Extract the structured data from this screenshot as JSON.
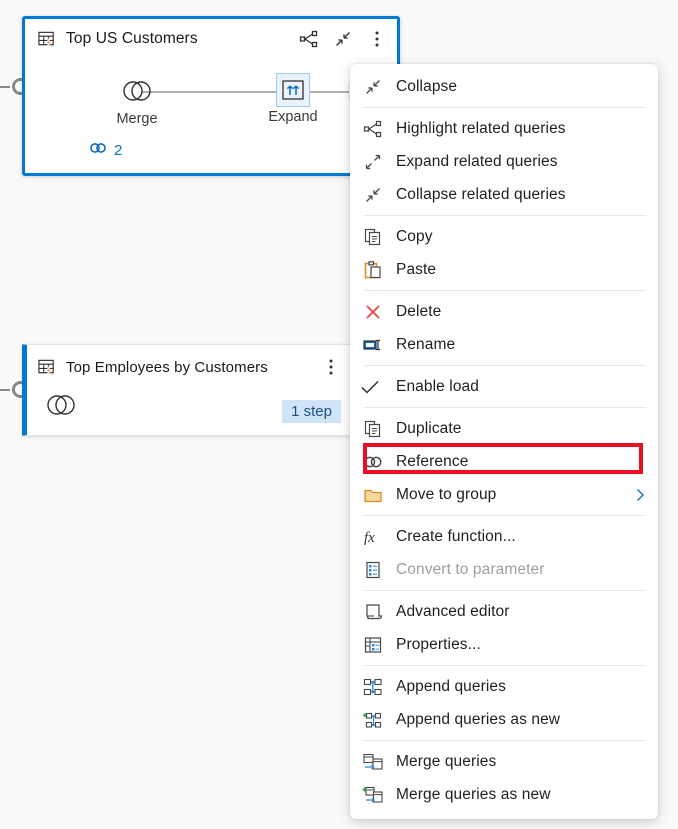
{
  "canvas": {
    "background": "#faf9f8",
    "accent": "#0078d4",
    "highlight_color": "#e81123"
  },
  "queries": [
    {
      "title": "Top US Customers",
      "selected": true,
      "icon": "table-query-icon",
      "header_actions": [
        {
          "name": "highlight-related-queries-icon",
          "label": "Highlight related queries"
        },
        {
          "name": "collapse-icon",
          "label": "Collapse"
        },
        {
          "name": "more-options-icon",
          "label": "More options"
        }
      ],
      "steps": [
        {
          "label": "Merge",
          "icon": "merge-icon",
          "active": false
        },
        {
          "label": "Expand",
          "icon": "expand-columns-icon",
          "active": true
        }
      ],
      "add_step_label": "+",
      "reference_count": "2",
      "reference_icon": "reference-link-icon"
    },
    {
      "title": "Top Employees by Customers",
      "selected": false,
      "icon": "table-query-icon",
      "header_actions": [
        {
          "name": "more-options-icon",
          "label": "More options"
        }
      ],
      "steps": [
        {
          "label": "",
          "icon": "merge-icon",
          "active": false
        }
      ],
      "step_badge": "1 step"
    }
  ],
  "context_menu": {
    "highlighted_item": "Reference",
    "groups": [
      {
        "items": [
          {
            "label": "Collapse",
            "icon": "collapse-icon",
            "disabled": false,
            "submenu": false
          }
        ]
      },
      {
        "items": [
          {
            "label": "Highlight related queries",
            "icon": "highlight-related-queries-icon",
            "disabled": false,
            "submenu": false
          },
          {
            "label": "Expand related queries",
            "icon": "expand-related-queries-icon",
            "disabled": false,
            "submenu": false
          },
          {
            "label": "Collapse related queries",
            "icon": "collapse-related-queries-icon",
            "disabled": false,
            "submenu": false
          }
        ]
      },
      {
        "items": [
          {
            "label": "Copy",
            "icon": "copy-icon",
            "disabled": false,
            "submenu": false
          },
          {
            "label": "Paste",
            "icon": "paste-icon",
            "disabled": false,
            "submenu": false
          }
        ]
      },
      {
        "items": [
          {
            "label": "Delete",
            "icon": "delete-icon",
            "disabled": false,
            "submenu": false
          },
          {
            "label": "Rename",
            "icon": "rename-icon",
            "disabled": false,
            "submenu": false
          }
        ]
      },
      {
        "items": [
          {
            "label": "Enable load",
            "icon": "checkmark-icon",
            "disabled": false,
            "submenu": false
          }
        ]
      },
      {
        "items": [
          {
            "label": "Duplicate",
            "icon": "duplicate-icon",
            "disabled": false,
            "submenu": false
          },
          {
            "label": "Reference",
            "icon": "reference-link-icon",
            "disabled": false,
            "submenu": false
          },
          {
            "label": "Move to group",
            "icon": "folder-icon",
            "disabled": false,
            "submenu": true
          }
        ]
      },
      {
        "items": [
          {
            "label": "Create function...",
            "icon": "function-icon",
            "disabled": false,
            "submenu": false
          },
          {
            "label": "Convert to parameter",
            "icon": "parameter-icon",
            "disabled": true,
            "submenu": false
          }
        ]
      },
      {
        "items": [
          {
            "label": "Advanced editor",
            "icon": "advanced-editor-icon",
            "disabled": false,
            "submenu": false
          },
          {
            "label": "Properties...",
            "icon": "properties-icon",
            "disabled": false,
            "submenu": false
          }
        ]
      },
      {
        "items": [
          {
            "label": "Append queries",
            "icon": "append-queries-icon",
            "disabled": false,
            "submenu": false
          },
          {
            "label": "Append queries as new",
            "icon": "append-queries-as-new-icon",
            "disabled": false,
            "submenu": false
          }
        ]
      },
      {
        "items": [
          {
            "label": "Merge queries",
            "icon": "merge-queries-icon",
            "disabled": false,
            "submenu": false
          },
          {
            "label": "Merge queries as new",
            "icon": "merge-queries-as-new-icon",
            "disabled": false,
            "submenu": false
          }
        ]
      }
    ]
  }
}
